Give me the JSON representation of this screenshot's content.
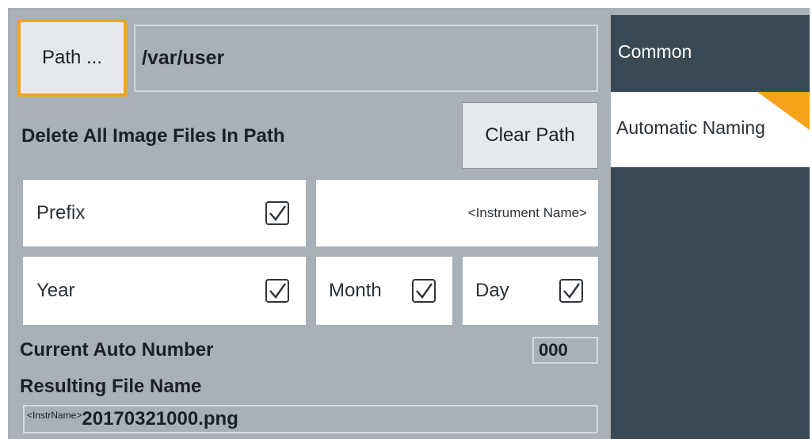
{
  "path": {
    "button_label": "Path ...",
    "value": "/var/user"
  },
  "delete_label": "Delete All Image Files In Path",
  "clear_path_label": "Clear Path",
  "options": {
    "prefix": {
      "label": "Prefix",
      "checked": true
    },
    "instrument_name": "<Instrument Name>",
    "year": {
      "label": "Year",
      "checked": true
    },
    "month": {
      "label": "Month",
      "checked": true
    },
    "day": {
      "label": "Day",
      "checked": true
    }
  },
  "current_auto_number": {
    "label": "Current Auto Number",
    "value": "000"
  },
  "resulting_file_name": {
    "label": "Resulting File Name",
    "prefix": "<InstrName>",
    "name": "20170321000.png"
  },
  "tabs": [
    {
      "label": "Common",
      "active": false
    },
    {
      "label": "Automatic Naming",
      "active": true
    }
  ],
  "colors": {
    "panel_bg": "#a7b1b7",
    "accent": "#f5a31a",
    "tab_dark": "#3a4a54"
  }
}
